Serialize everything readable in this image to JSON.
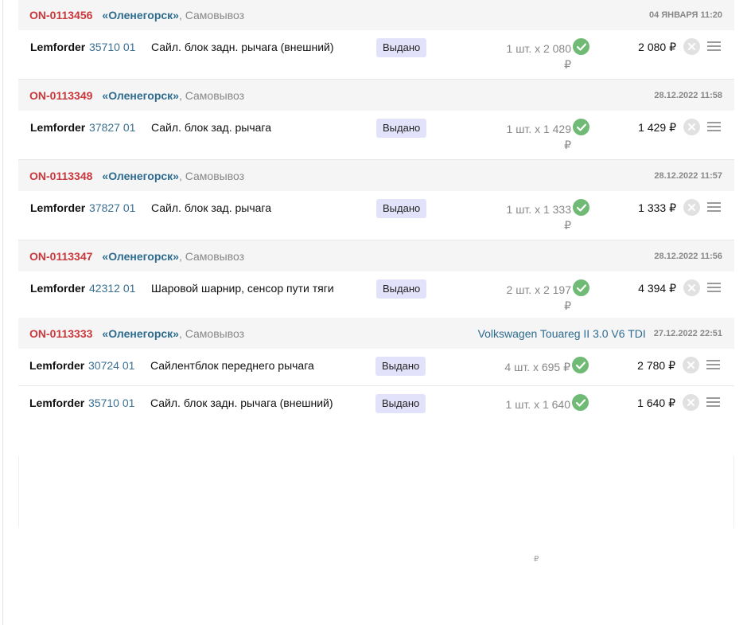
{
  "orders": [
    {
      "number": "ON-0113456",
      "city": "«Оленегорск»",
      "delivery": ", Самовывоз",
      "car": "",
      "date": "04 ЯНВАРЯ 11:20",
      "items": [
        {
          "brand": "Lemforder",
          "article": "35710 01",
          "description": "Сайл. блок задн. рычага (внешний)",
          "status": "Выдано",
          "qty_line1": "1 шт. х 2 080",
          "qty_line2": "₽",
          "total": "2 080 ₽"
        }
      ]
    },
    {
      "number": "ON-0113349",
      "city": "«Оленегорск»",
      "delivery": ", Самовывоз",
      "car": "",
      "date": "28.12.2022 11:58",
      "items": [
        {
          "brand": "Lemforder",
          "article": "37827 01",
          "description": "Сайл. блок зад. рычага",
          "status": "Выдано",
          "qty_line1": "1 шт. х 1 429",
          "qty_line2": "₽",
          "total": "1 429 ₽"
        }
      ]
    },
    {
      "number": "ON-0113348",
      "city": "«Оленегорск»",
      "delivery": ", Самовывоз",
      "car": "",
      "date": "28.12.2022 11:57",
      "items": [
        {
          "brand": "Lemforder",
          "article": "37827 01",
          "description": "Сайл. блок зад. рычага",
          "status": "Выдано",
          "qty_line1": "1 шт. х 1 333",
          "qty_line2": "₽",
          "total": "1 333 ₽"
        }
      ]
    },
    {
      "number": "ON-0113347",
      "city": "«Оленегорск»",
      "delivery": ", Самовывоз",
      "car": "",
      "date": "28.12.2022 11:56",
      "items": [
        {
          "brand": "Lemforder",
          "article": "42312 01",
          "description": "Шаровой шарнир, сенсор пути тяги",
          "status": "Выдано",
          "qty_line1": "2 шт. х 2 197",
          "qty_line2": "₽",
          "total": "4 394 ₽"
        }
      ]
    },
    {
      "number": "ON-0113333",
      "city": "«Оленегорск»",
      "delivery": ", Самовывоз",
      "car": "Volkswagen Touareg II 3.0 V6 TDI",
      "date": "27.12.2022 22:51",
      "items": [
        {
          "brand": "Lemforder",
          "article": "30724 01",
          "description": "Сайлентблок переднего рычага",
          "status": "Выдано",
          "qty_line1": "4 шт. х 695 ₽",
          "qty_line2": "",
          "total": "2 780 ₽"
        },
        {
          "brand": "Lemforder",
          "article": "35710 01",
          "description": "Сайл. блок задн. рычага (внешний)",
          "status": "Выдано",
          "qty_line1": "1 шт. х 1 640",
          "qty_line2": "",
          "total": "1 640 ₽"
        }
      ]
    }
  ],
  "stray_ruble": "₽",
  "icons": {
    "ok": "check-circle-icon",
    "cancel": "close-circle-icon",
    "menu": "menu-lines-icon"
  },
  "colors": {
    "order_number": "#c8383c",
    "city": "#2d6b8f",
    "status_bg": "#e3e2fb",
    "ok_green": "#6fba74"
  }
}
